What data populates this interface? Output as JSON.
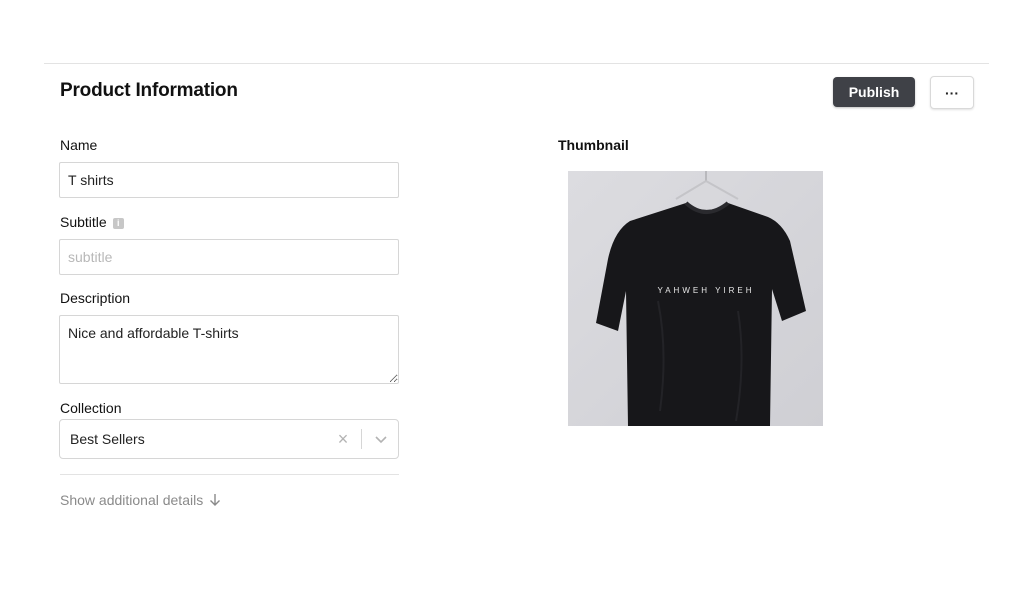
{
  "header": {
    "title": "Product Information",
    "publish_label": "Publish",
    "more_label": "···"
  },
  "form": {
    "name": {
      "label": "Name",
      "value": "T shirts"
    },
    "subtitle": {
      "label": "Subtitle",
      "value": "",
      "placeholder": "subtitle",
      "info_icon": "info-icon"
    },
    "description": {
      "label": "Description",
      "value": "Nice and affordable T-shirts"
    },
    "collection": {
      "label": "Collection",
      "value": "Best Sellers",
      "clear_icon": "close-icon",
      "dropdown_icon": "chevron-down-icon"
    },
    "show_more_label": "Show additional details",
    "show_more_icon": "arrow-down-icon"
  },
  "thumbnail": {
    "label": "Thumbnail",
    "shirt_print": "YAHWEH YIREH",
    "colors": {
      "background": "#d9d9dd",
      "shirt": "#17171a"
    }
  },
  "colors": {
    "publish_bg": "#3f4147",
    "border": "#d6d6d6",
    "muted": "#8a8a8a"
  }
}
